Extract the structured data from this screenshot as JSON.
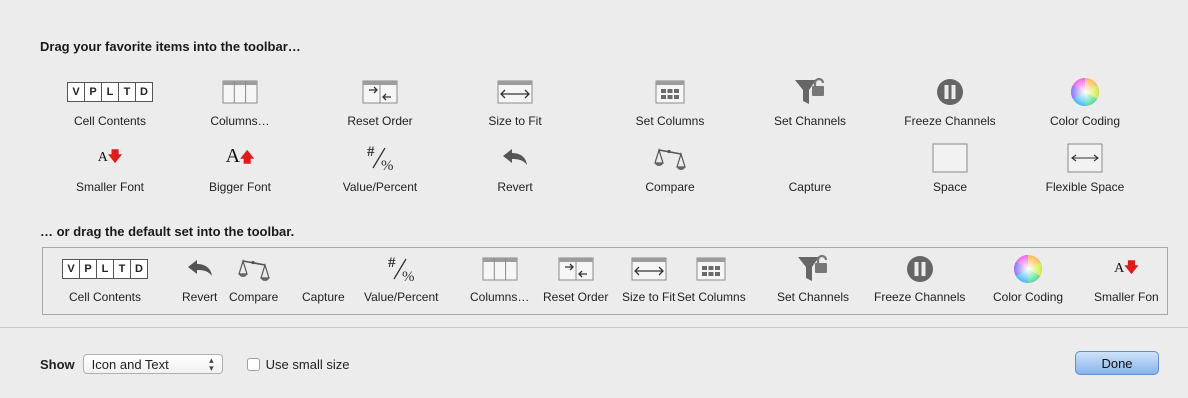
{
  "headings": {
    "top": "Drag your favorite items into the toolbar…",
    "default": "… or drag the default set into the toolbar."
  },
  "cell_letters": [
    "V",
    "P",
    "L",
    "T",
    "D"
  ],
  "palette": [
    {
      "label": "Cell Contents",
      "icon": "cell-contents-icon"
    },
    {
      "label": "Columns…",
      "icon": "columns-icon"
    },
    {
      "label": "Reset Order",
      "icon": "reset-order-icon"
    },
    {
      "label": "Size to Fit",
      "icon": "size-to-fit-icon"
    },
    {
      "label": "Set Columns",
      "icon": "set-columns-icon"
    },
    {
      "label": "Set Channels",
      "icon": "set-channels-icon"
    },
    {
      "label": "Freeze Channels",
      "icon": "freeze-channels-icon"
    },
    {
      "label": "Color Coding",
      "icon": "color-coding-icon"
    },
    {
      "label": "Smaller Font",
      "icon": "smaller-font-icon"
    },
    {
      "label": "Bigger Font",
      "icon": "bigger-font-icon"
    },
    {
      "label": "Value/Percent",
      "icon": "value-percent-icon"
    },
    {
      "label": "Revert",
      "icon": "revert-icon"
    },
    {
      "label": "Compare",
      "icon": "compare-icon"
    },
    {
      "label": "Capture",
      "icon": "capture-icon"
    },
    {
      "label": "Space",
      "icon": "space-icon"
    },
    {
      "label": "Flexible Space",
      "icon": "flexible-space-icon"
    }
  ],
  "default_set": [
    {
      "label": "Cell Contents",
      "icon": "cell-contents-icon"
    },
    {
      "label": "Revert",
      "icon": "revert-icon"
    },
    {
      "label": "Compare",
      "icon": "compare-icon"
    },
    {
      "label": "Capture",
      "icon": "capture-icon"
    },
    {
      "label": "Value/Percent",
      "icon": "value-percent-icon"
    },
    {
      "label": "Columns…",
      "icon": "columns-icon"
    },
    {
      "label": "Reset Order",
      "icon": "reset-order-icon"
    },
    {
      "label": "Size to Fit",
      "icon": "size-to-fit-icon"
    },
    {
      "label": "Set Columns",
      "icon": "set-columns-icon"
    },
    {
      "label": "Set Channels",
      "icon": "set-channels-icon"
    },
    {
      "label": "Freeze Channels",
      "icon": "freeze-channels-icon"
    },
    {
      "label": "Color Coding",
      "icon": "color-coding-icon"
    },
    {
      "label": "Smaller Fon",
      "icon": "smaller-font-icon"
    }
  ],
  "footer": {
    "show_label": "Show",
    "show_value": "Icon and Text",
    "small_size_label": "Use small size",
    "small_size_checked": false,
    "done_label": "Done"
  },
  "colors": {
    "background": "#ececec",
    "accent_button": "#86b3ec",
    "font_arrow": "#e01b1b"
  }
}
